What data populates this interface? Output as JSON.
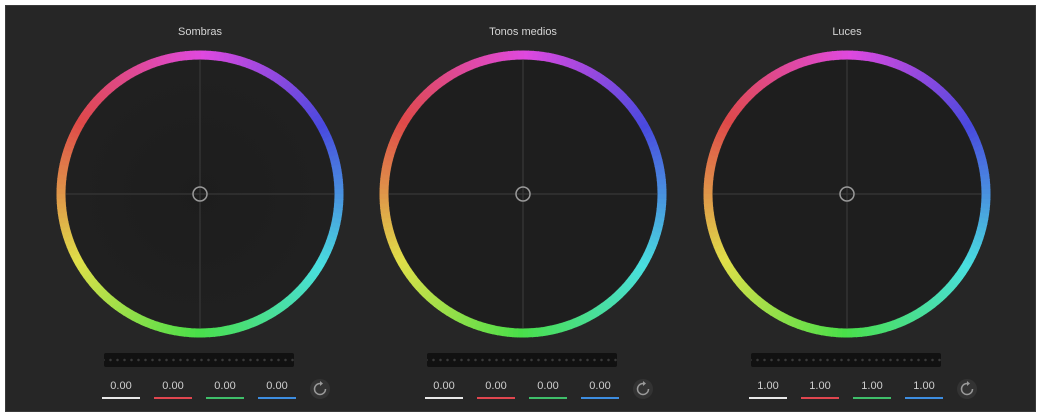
{
  "wheels": [
    {
      "title": "Sombras",
      "values": [
        "0.00",
        "0.00",
        "0.00",
        "0.00"
      ]
    },
    {
      "title": "Tonos medios",
      "values": [
        "0.00",
        "0.00",
        "0.00",
        "0.00"
      ]
    },
    {
      "title": "Luces",
      "values": [
        "1.00",
        "1.00",
        "1.00",
        "1.00"
      ]
    }
  ],
  "channel_colors": [
    "#e8e8e8",
    "#e0464f",
    "#3fbf6a",
    "#3d8de0"
  ],
  "icons": {
    "reset": "reset-icon"
  }
}
